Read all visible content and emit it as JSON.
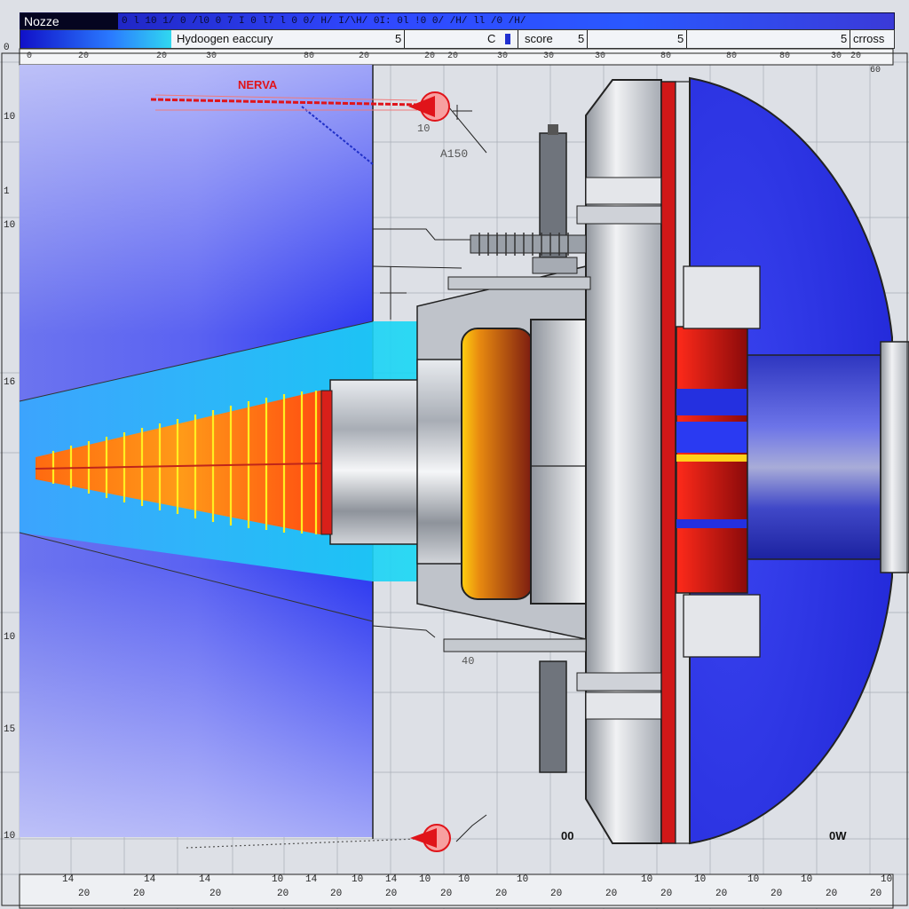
{
  "window": {
    "title": "Nozze"
  },
  "title_bar_ticks": "0        l   10 1/ 0 /l0      0 7 I  0   l7    l    0 0/  H/   I/\\H/ 0I:  0l !0 0/ /H/   ll   /0    /H/",
  "toolbar": {
    "field1": "Hydoogen eaccury",
    "field1_value": "5",
    "field2_prefix": "C",
    "field2_label": "score",
    "field2_value": "5",
    "field3_value": "5",
    "field4_value": "5",
    "field4_label": "crross"
  },
  "top_axis_labels": [
    "0",
    "20",
    "20",
    "30",
    "80",
    "20",
    "20",
    "20",
    "30",
    "30",
    "30",
    "80",
    "80",
    "80",
    "30",
    "20",
    "60"
  ],
  "left_axis_labels": [
    "0",
    "10",
    "1",
    "10",
    "16",
    "10",
    "15",
    "10"
  ],
  "annotations": {
    "nerva": "NERVA",
    "a150": "A150",
    "n10": "10",
    "n40": "40",
    "n00": "00",
    "n0w": "0W"
  },
  "bottom_axis_top": [
    "14",
    "14",
    "14",
    "10",
    "14",
    "10",
    "14",
    "10",
    "10",
    "10",
    "10",
    "10",
    "10",
    "10",
    "10"
  ],
  "bottom_axis_low": [
    "20",
    "20",
    "20",
    "20",
    "20",
    "20",
    "20",
    "20",
    "20",
    "20",
    "20",
    "20",
    "20",
    "20",
    "20"
  ],
  "colors": {
    "plume_blue": "#2a3cf0",
    "exhaust_cyan": "#1ec8ff",
    "flame_yellow": "#ffe81a",
    "flame_orange": "#ff7a10",
    "reactor_red": "#d01818",
    "shield_blue": "#2a32e8",
    "steel": "#b9bec6"
  }
}
